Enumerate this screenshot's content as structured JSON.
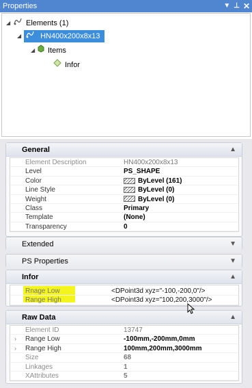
{
  "window": {
    "title": "Properties"
  },
  "tree": {
    "root": "Elements (1)",
    "element": "HN400x200x8x13",
    "items": "Items",
    "infor": "Infor"
  },
  "sections": {
    "general": {
      "title": "General",
      "rows": [
        {
          "label": "Element Description",
          "value": "HN400x200x8x13"
        },
        {
          "label": "Level",
          "value": "PS_SHAPE"
        },
        {
          "label": "Color",
          "value": "ByLevel (161)"
        },
        {
          "label": "Line Style",
          "value": "ByLevel (0)"
        },
        {
          "label": "Weight",
          "value": "ByLevel (0)"
        },
        {
          "label": "Class",
          "value": "Primary"
        },
        {
          "label": "Template",
          "value": "(None)"
        },
        {
          "label": "Transparency",
          "value": "0"
        }
      ]
    },
    "extended": {
      "title": "Extended"
    },
    "ps_properties": {
      "title": "PS Properties"
    },
    "infor": {
      "title": "Infor",
      "rows": [
        {
          "label": "Rnage Low",
          "value": "<DPoint3d xyz=\"-100,-200,0\"/>"
        },
        {
          "label": "Range High",
          "value": "<DPoint3d xyz=\"100,200,3000\"/>"
        }
      ]
    },
    "raw_data": {
      "title": "Raw Data",
      "rows": [
        {
          "label": "Element ID",
          "value": "13747"
        },
        {
          "label": "Range Low",
          "value": "-100mm,-200mm,0mm"
        },
        {
          "label": "Range High",
          "value": "100mm,200mm,3000mm"
        },
        {
          "label": "Size",
          "value": "68"
        },
        {
          "label": "Linkages",
          "value": "1"
        },
        {
          "label": "XAttributes",
          "value": "5"
        }
      ]
    }
  },
  "colors": {
    "titlebar": "#4f86cf",
    "selection": "#3c8ddc",
    "highlight": "#f3f51c"
  }
}
